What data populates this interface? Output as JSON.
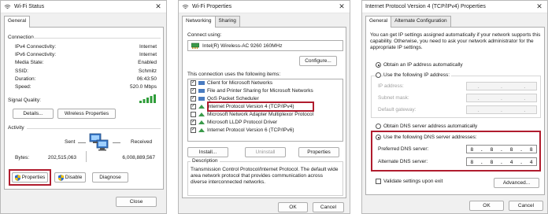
{
  "wifi_status": {
    "title": "Wi-Fi Status",
    "tab": "General",
    "connection_header": "Connection",
    "rows": [
      {
        "label": "IPv4 Connectivity:",
        "value": "Internet"
      },
      {
        "label": "IPv6 Connectivity:",
        "value": "Internet"
      },
      {
        "label": "Media State:",
        "value": "Enabled"
      },
      {
        "label": "SSID:",
        "value": "Schmitz"
      },
      {
        "label": "Duration:",
        "value": "06:43:50"
      },
      {
        "label": "Speed:",
        "value": "520.0 Mbps"
      }
    ],
    "signal_quality_label": "Signal Quality:",
    "details_button": "Details...",
    "wireless_properties_button": "Wireless Properties",
    "activity_header": "Activity",
    "sent_label": "Sent",
    "received_label": "Received",
    "bytes_label": "Bytes:",
    "bytes_sent": "202,515,063",
    "bytes_received": "6,008,889,567",
    "properties_button": "Properties",
    "disable_button": "Disable",
    "diagnose_button": "Diagnose",
    "close_button": "Close"
  },
  "wifi_properties": {
    "title": "Wi-Fi Properties",
    "tabs": [
      "Networking",
      "Sharing"
    ],
    "connect_using_label": "Connect using:",
    "adapter_name": "Intel(R) Wireless-AC 9260 160MHz",
    "configure_button": "Configure...",
    "items_label": "This connection uses the following items:",
    "items": [
      {
        "label": "Client for Microsoft Networks",
        "checked": true
      },
      {
        "label": "File and Printer Sharing for Microsoft Networks",
        "checked": true
      },
      {
        "label": "QoS Packet Scheduler",
        "checked": true
      },
      {
        "label": "Internet Protocol Version 4 (TCP/IPv4)",
        "checked": true
      },
      {
        "label": "Microsoft Network Adapter Multiplexor Protocol",
        "checked": false
      },
      {
        "label": "Microsoft LLDP Protocol Driver",
        "checked": true
      },
      {
        "label": "Internet Protocol Version 6 (TCP/IPv6)",
        "checked": true
      }
    ],
    "install_button": "Install...",
    "uninstall_button": "Uninstall",
    "properties_button": "Properties",
    "description_label": "Description",
    "description_text": "Transmission Control Protocol/Internet Protocol. The default wide area network protocol that provides communication across diverse interconnected networks.",
    "ok_button": "OK",
    "cancel_button": "Cancel"
  },
  "ipv4_properties": {
    "title": "Internet Protocol Version 4 (TCP/IPv4) Properties",
    "tabs": [
      "General",
      "Alternate Configuration"
    ],
    "intro_text": "You can get IP settings assigned automatically if your network supports this capability. Otherwise, you need to ask your network administrator for the appropriate IP settings.",
    "obtain_ip_auto": "Obtain an IP address automatically",
    "use_following_ip": "Use the following IP address:",
    "ip_address_label": "IP address:",
    "subnet_mask_label": "Subnet mask:",
    "default_gateway_label": "Default gateway:",
    "obtain_dns_auto": "Obtain DNS server address automatically",
    "use_following_dns": "Use the following DNS server addresses:",
    "preferred_dns_label": "Preferred DNS server:",
    "preferred_dns": [
      "8",
      "8",
      "8",
      "8"
    ],
    "alternate_dns_label": "Alternate DNS server:",
    "alternate_dns": [
      "8",
      "8",
      "4",
      "4"
    ],
    "validate_label": "Validate settings upon exit",
    "advanced_button": "Advanced...",
    "ok_button": "OK",
    "cancel_button": "Cancel"
  },
  "colors": {
    "highlight_red": "#b01c2e",
    "signal_green": "#2f9d3a"
  },
  "icons": [
    "wifi-icon",
    "network-adapter-icon",
    "computers-icon",
    "shield-icon",
    "protocol-icon",
    "close-icon"
  ]
}
